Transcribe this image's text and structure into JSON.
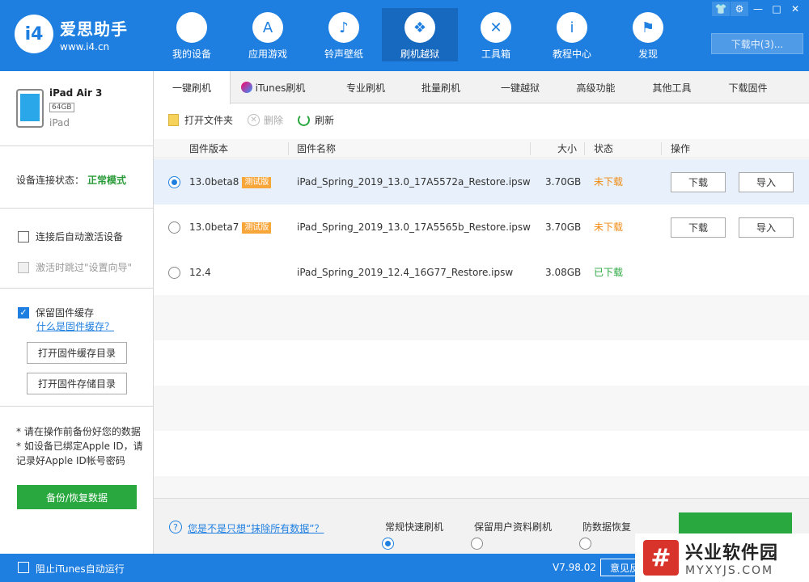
{
  "app": {
    "logo_mark": "i4",
    "name": "爱思助手",
    "url": "www.i4.cn"
  },
  "nav": [
    {
      "label": "我的设备",
      "icon": "apple-icon",
      "glyph": ""
    },
    {
      "label": "应用游戏",
      "icon": "appstore-icon",
      "glyph": "A"
    },
    {
      "label": "铃声壁纸",
      "icon": "music-icon",
      "glyph": "♪"
    },
    {
      "label": "刷机越狱",
      "icon": "dropbox-icon",
      "glyph": "❖"
    },
    {
      "label": "工具箱",
      "icon": "tools-icon",
      "glyph": "✕"
    },
    {
      "label": "教程中心",
      "icon": "info-icon",
      "glyph": "i"
    },
    {
      "label": "发现",
      "icon": "flag-icon",
      "glyph": "⚑"
    }
  ],
  "window_controls": [
    "👕",
    "⚙",
    "—",
    "□",
    "✕"
  ],
  "download_button": "下载中(3)...",
  "device": {
    "name": "iPad Air 3",
    "capacity": "64GB",
    "type": "iPad"
  },
  "connection": {
    "label": "设备连接状态：",
    "value": "正常模式"
  },
  "options": {
    "auto_activate": "连接后自动激活设备",
    "skip_setup": "激活时跳过\"设置向导\""
  },
  "cache": {
    "keep_label": "保留固件缓存",
    "what_link": "什么是固件缓存？",
    "open_cache_btn": "打开固件缓存目录",
    "open_store_btn": "打开固件存储目录"
  },
  "notes": {
    "line1": "* 请在操作前备份好您的数据",
    "line2": "* 如设备已绑定Apple ID，请记录好Apple ID帐号密码"
  },
  "backup_button": "备份/恢复数据",
  "tabs": [
    {
      "label": "一键刷机"
    },
    {
      "label": "iTunes刷机"
    },
    {
      "label": "专业刷机"
    },
    {
      "label": "批量刷机"
    },
    {
      "label": "一键越狱"
    },
    {
      "label": "高级功能"
    },
    {
      "label": "其他工具"
    },
    {
      "label": "下载固件"
    }
  ],
  "toolbar": {
    "open_folder": "打开文件夹",
    "delete": "删除",
    "refresh": "刷新"
  },
  "table": {
    "headers": {
      "version": "固件版本",
      "name": "固件名称",
      "size": "大小",
      "status": "状态",
      "action": "操作"
    },
    "rows": [
      {
        "version": "13.0beta8",
        "beta": "测试版",
        "name": "iPad_Spring_2019_13.0_17A5572a_Restore.ipsw",
        "size": "3.70GB",
        "status": "未下载",
        "download": "下载",
        "import": "导入"
      },
      {
        "version": "13.0beta7",
        "beta": "测试版",
        "name": "iPad_Spring_2019_13.0_17A5565b_Restore.ipsw",
        "size": "3.70GB",
        "status": "未下载",
        "download": "下载",
        "import": "导入"
      },
      {
        "version": "12.4",
        "beta": "",
        "name": "iPad_Spring_2019_12.4_16G77_Restore.ipsw",
        "size": "3.08GB",
        "status": "已下载"
      }
    ]
  },
  "bottom": {
    "question": "您是不是只想“抹除所有数据”？",
    "mode1": "常规快速刷机",
    "mode2": "保留用户资料刷机",
    "mode3": "防数据恢复"
  },
  "statusbar": {
    "itunes_block": "阻止iTunes自动运行",
    "version": "V7.98.02",
    "feedback": "意见反"
  },
  "watermark": {
    "logo": "#",
    "cn": "兴业软件园",
    "en": "MYXYJS.COM"
  },
  "colors": {
    "brand_blue": "#1f7fe0",
    "green": "#2aa840",
    "orange": "#f08a12"
  }
}
